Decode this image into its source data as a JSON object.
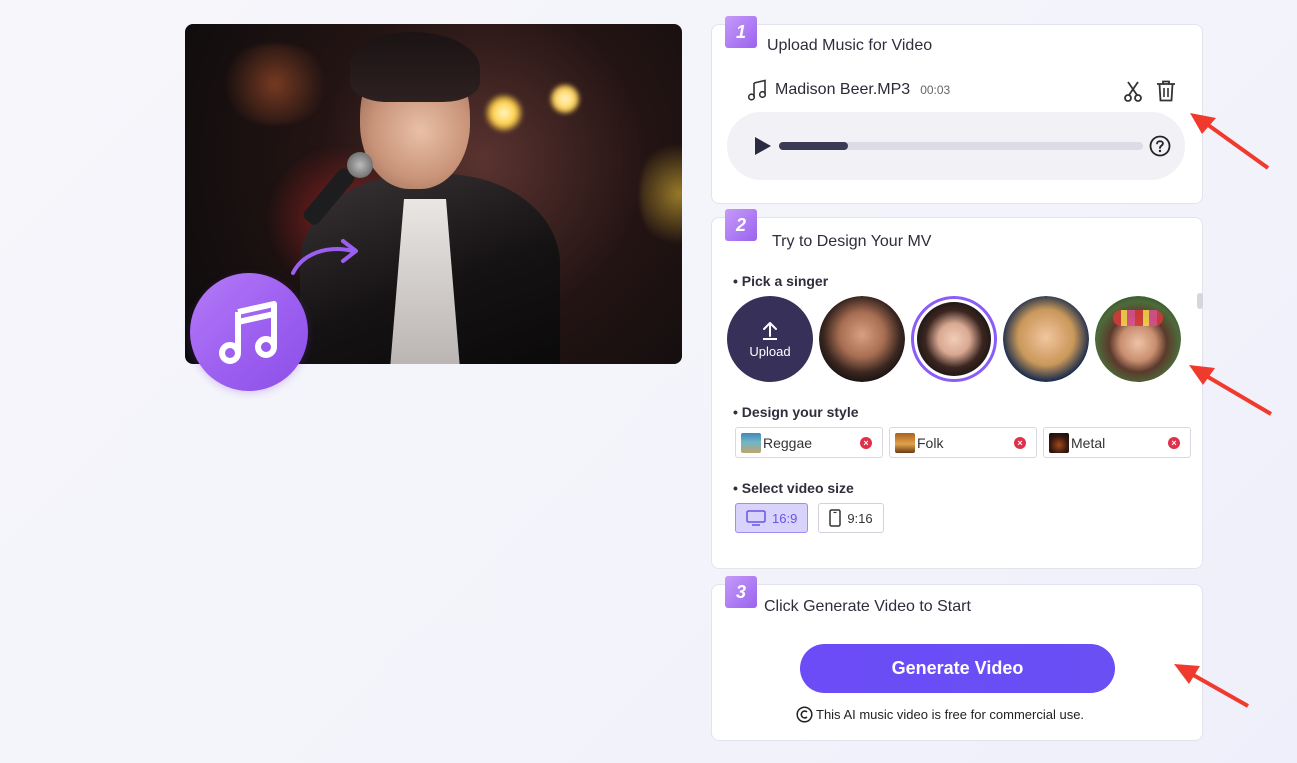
{
  "colors": {
    "accent": "#6b4cf6",
    "step_badge": "#a56cf2",
    "remove": "#e0304a",
    "annotation_arrow": "#f03a2e"
  },
  "preview": {
    "badge_icon": "music-note-icon",
    "arrow_icon": "curved-arrow-icon"
  },
  "step1": {
    "number": "1",
    "title": "Upload Music for Video",
    "file_icon": "music-note-icon",
    "file_name": "Madison Beer.MP3",
    "file_duration": "00:03",
    "progress": 0.19,
    "actions": [
      "scissors-icon",
      "trash-icon"
    ],
    "help_icon": "question-circle-icon"
  },
  "step2": {
    "number": "2",
    "title": "Try to Design Your MV",
    "singer_label": "• Pick a singer",
    "upload_label": "Upload",
    "singers": [
      "male-singer-1",
      "female-singer-selected",
      "female-singer-blonde",
      "female-singer-flowers"
    ],
    "style_label": "• Design your style",
    "styles": [
      {
        "name": "Reggae"
      },
      {
        "name": "Folk"
      },
      {
        "name": "Metal"
      }
    ],
    "size_label": "• Select video size",
    "sizes": [
      {
        "label": "16:9",
        "icon": "monitor-icon",
        "active": true
      },
      {
        "label": "9:16",
        "icon": "phone-icon",
        "active": false
      }
    ]
  },
  "step3": {
    "number": "3",
    "title": "Click Generate Video to Start",
    "button_label": "Generate Video",
    "note": "This AI music video is free for commercial use.",
    "note_icon": "copyright-icon"
  }
}
